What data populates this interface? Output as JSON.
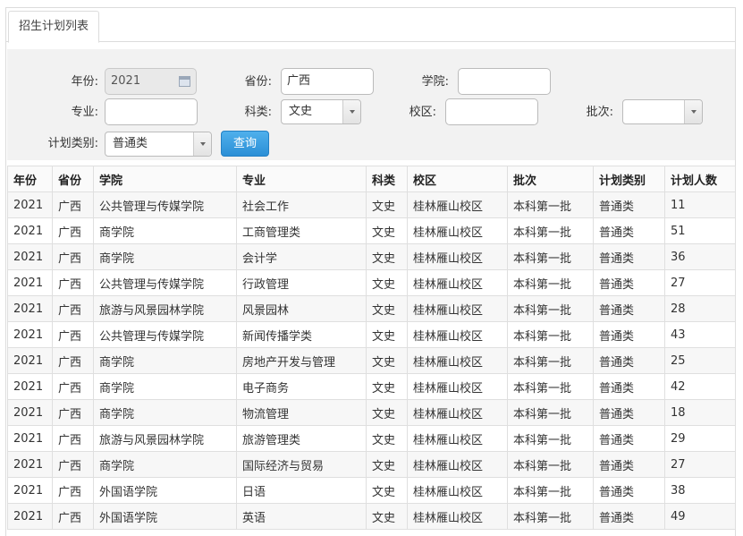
{
  "tab": {
    "label": "招生计划列表"
  },
  "search": {
    "year_label": "年份:",
    "year_value": "2021",
    "province_label": "省份:",
    "province_value": "广西",
    "college_label": "学院:",
    "college_value": "",
    "major_label": "专业:",
    "major_value": "",
    "subject_label": "科类:",
    "subject_value": "文史",
    "campus_label": "校区:",
    "campus_value": "",
    "batch_label": "批次:",
    "batch_value": "",
    "plan_type_label": "计划类别:",
    "plan_type_value": "普通类",
    "query_button": "查询"
  },
  "table": {
    "headers": [
      "年份",
      "省份",
      "学院",
      "专业",
      "科类",
      "校区",
      "批次",
      "计划类别",
      "计划人数"
    ],
    "rows": [
      [
        "2021",
        "广西",
        "公共管理与传媒学院",
        "社会工作",
        "文史",
        "桂林雁山校区",
        "本科第一批",
        "普通类",
        "11"
      ],
      [
        "2021",
        "广西",
        "商学院",
        "工商管理类",
        "文史",
        "桂林雁山校区",
        "本科第一批",
        "普通类",
        "51"
      ],
      [
        "2021",
        "广西",
        "商学院",
        "会计学",
        "文史",
        "桂林雁山校区",
        "本科第一批",
        "普通类",
        "36"
      ],
      [
        "2021",
        "广西",
        "公共管理与传媒学院",
        "行政管理",
        "文史",
        "桂林雁山校区",
        "本科第一批",
        "普通类",
        "27"
      ],
      [
        "2021",
        "广西",
        "旅游与风景园林学院",
        "风景园林",
        "文史",
        "桂林雁山校区",
        "本科第一批",
        "普通类",
        "28"
      ],
      [
        "2021",
        "广西",
        "公共管理与传媒学院",
        "新闻传播学类",
        "文史",
        "桂林雁山校区",
        "本科第一批",
        "普通类",
        "43"
      ],
      [
        "2021",
        "广西",
        "商学院",
        "房地产开发与管理",
        "文史",
        "桂林雁山校区",
        "本科第一批",
        "普通类",
        "25"
      ],
      [
        "2021",
        "广西",
        "商学院",
        "电子商务",
        "文史",
        "桂林雁山校区",
        "本科第一批",
        "普通类",
        "42"
      ],
      [
        "2021",
        "广西",
        "商学院",
        "物流管理",
        "文史",
        "桂林雁山校区",
        "本科第一批",
        "普通类",
        "18"
      ],
      [
        "2021",
        "广西",
        "旅游与风景园林学院",
        "旅游管理类",
        "文史",
        "桂林雁山校区",
        "本科第一批",
        "普通类",
        "29"
      ],
      [
        "2021",
        "广西",
        "商学院",
        "国际经济与贸易",
        "文史",
        "桂林雁山校区",
        "本科第一批",
        "普通类",
        "27"
      ],
      [
        "2021",
        "广西",
        "外国语学院",
        "日语",
        "文史",
        "桂林雁山校区",
        "本科第一批",
        "普通类",
        "38"
      ],
      [
        "2021",
        "广西",
        "外国语学院",
        "英语",
        "文史",
        "桂林雁山校区",
        "本科第一批",
        "普通类",
        "49"
      ]
    ]
  }
}
